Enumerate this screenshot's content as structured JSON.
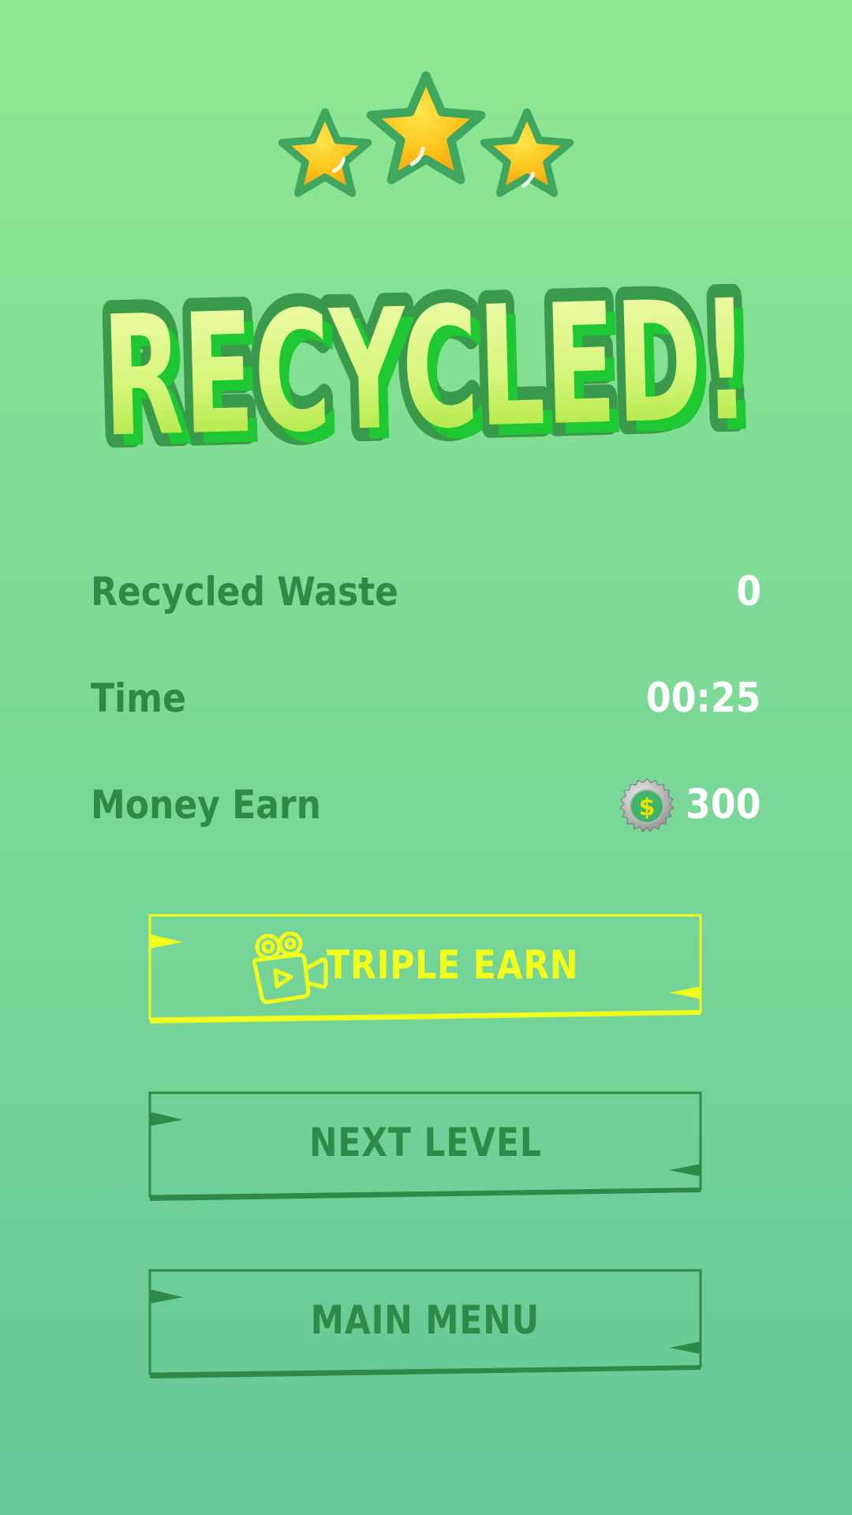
{
  "stars": {
    "earned": 3,
    "total": 3
  },
  "title": "RECYCLED!",
  "stats": [
    {
      "label": "Recycled Waste",
      "value": "0"
    },
    {
      "label": "Time",
      "value": "00:25"
    },
    {
      "label": "Money Earn",
      "value": "300",
      "icon": "bottle-cap-coin-icon"
    }
  ],
  "buttons": {
    "triple_earn": "TRIPLE EARN",
    "next_level": "NEXT LEVEL",
    "main_menu": "MAIN MENU"
  },
  "colors": {
    "label_green": "#2f8a4a",
    "accent_yellow": "#f2ff1a",
    "value_white": "#ffffff"
  }
}
